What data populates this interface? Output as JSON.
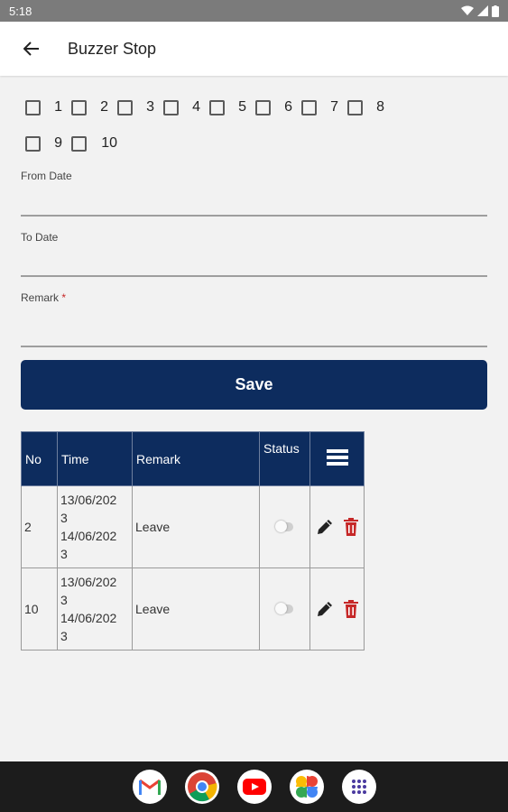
{
  "status_bar": {
    "time": "5:18"
  },
  "header": {
    "title": "Buzzer Stop"
  },
  "checkboxes": {
    "row1": [
      "1",
      "2",
      "3",
      "4",
      "5",
      "6",
      "7",
      "8"
    ],
    "row2": [
      "9",
      "10"
    ]
  },
  "form": {
    "from_date_label": "From Date",
    "to_date_label": "To Date",
    "remark_label": "Remark",
    "required_mark": "*",
    "save_label": "Save"
  },
  "table": {
    "headers": {
      "no": "No",
      "time": "Time",
      "remark": "Remark",
      "status": "Status"
    },
    "rows": [
      {
        "no": "2",
        "time_l1": "13/06/202",
        "time_l2": "3",
        "time_l3": "14/06/202",
        "time_l4": "3",
        "remark": "Leave",
        "status": "off"
      },
      {
        "no": "10",
        "time_l1": "13/06/202",
        "time_l2": "3",
        "time_l3": "14/06/202",
        "time_l4": "3",
        "remark": "Leave",
        "status": "off"
      }
    ]
  },
  "colors": {
    "primary": "#0d2c5e",
    "delete": "#c62828"
  },
  "icons": [
    "back-arrow-icon",
    "table-menu-icon",
    "edit-pencil-icon",
    "delete-trash-icon",
    "gmail-icon",
    "chrome-icon",
    "youtube-icon",
    "photos-icon",
    "apps-icon"
  ]
}
